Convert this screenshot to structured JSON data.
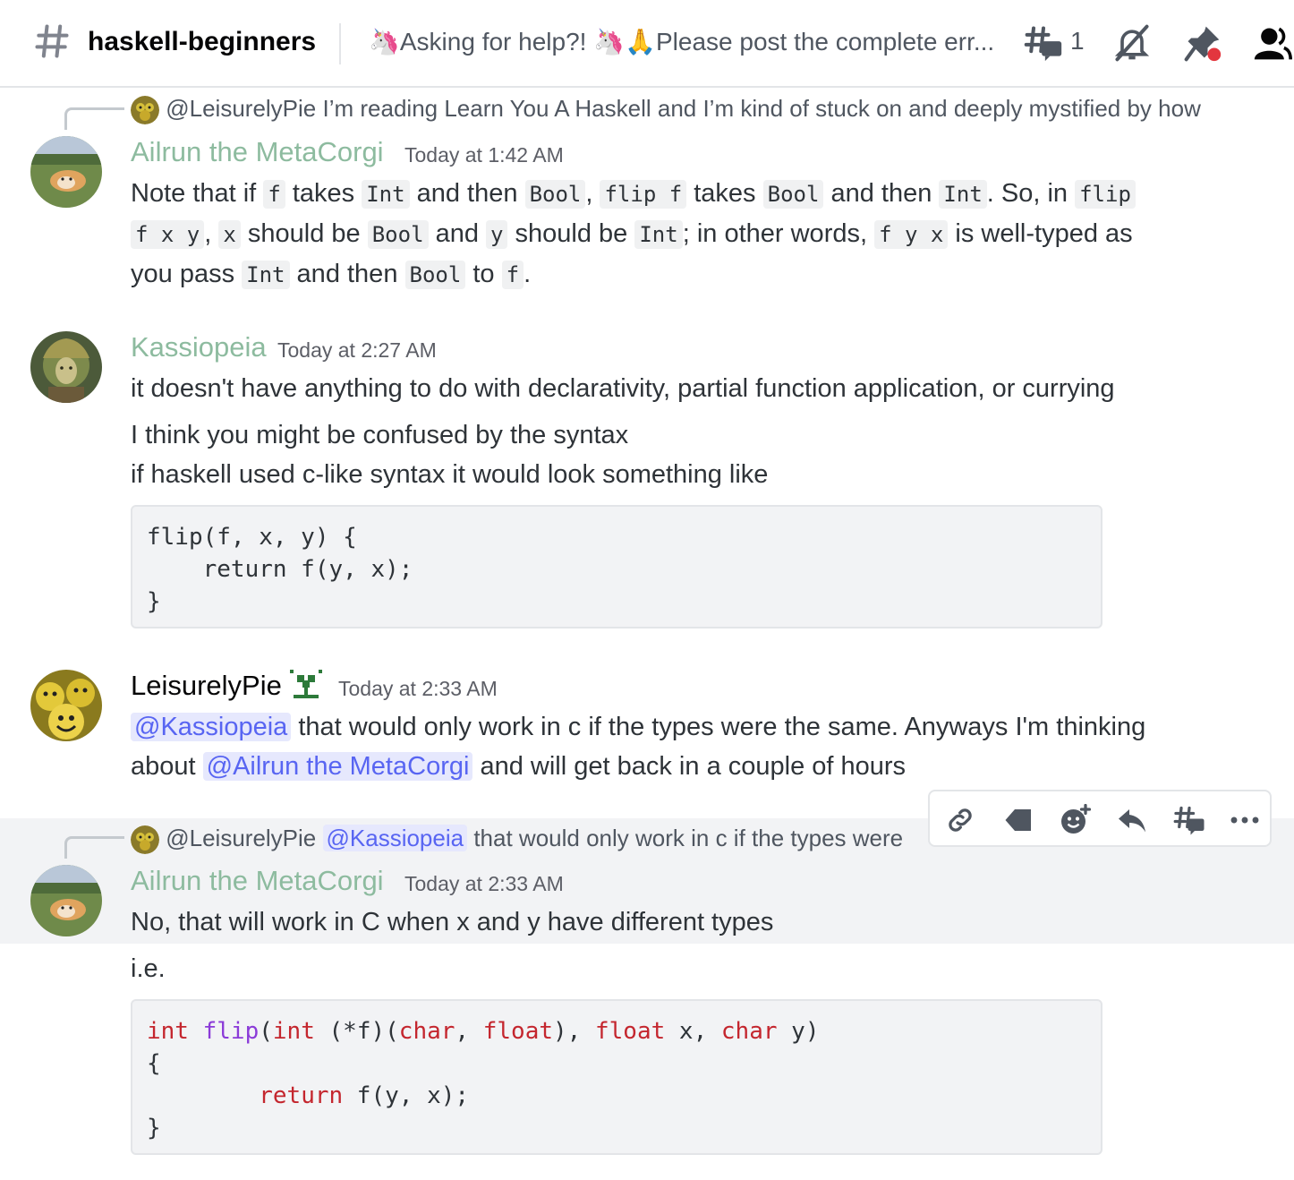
{
  "header": {
    "channel": "haskell-beginners",
    "topic_part1": "Asking for help?!",
    "topic_part2": "Please post the complete err...",
    "threads_count": "1"
  },
  "messages": [
    {
      "reply": {
        "author": "@LeisurelyPie",
        "text": "I’m reading Learn You A Haskell and I’m kind of stuck on and deeply mystified by how"
      },
      "author": "Ailrun the MetaCorgi",
      "timestamp": "Today at 1:42 AM",
      "text": {
        "t1": "Note that if ",
        "c1": "f",
        "t2": " takes ",
        "c2": "Int",
        "t3": " and then ",
        "c3": "Bool",
        "t4": ", ",
        "c4": "flip f",
        "t5": " takes ",
        "c5": "Bool",
        "t6": " and then ",
        "c6": "Int",
        "t7": ". So, in ",
        "c7": "flip",
        "c8": "f x y",
        "t8": ", ",
        "c9": "x",
        "t9": " should be ",
        "c10": "Bool",
        "t10": " and ",
        "c11": "y",
        "t11": " should be ",
        "c12": "Int",
        "t12": "; in other words, ",
        "c13": "f y x",
        "t13": " is well-typed as",
        "t14": "you pass ",
        "c14": "Int",
        "t15": " and then ",
        "c15": "Bool",
        "t16": " to ",
        "c16": "f",
        "t17": "."
      }
    },
    {
      "author": "Kassiopeia",
      "timestamp": "Today at 2:27 AM",
      "line1": "it doesn't have anything to do with declarativity, partial function application, or currying",
      "line2": "I think you might be confused by the syntax",
      "line3": "if haskell used c-like syntax it would look something like",
      "code": "flip(f, x, y) {\n    return f(y, x);\n}"
    },
    {
      "author": "LeisurelyPie",
      "timestamp": "Today at 2:33 AM",
      "mention1": "@Kassiopeia",
      "t1": " that would only work in c if the types were the same. Anyways I'm thinking",
      "t2": "about ",
      "mention2": "@Ailrun the MetaCorgi",
      "t3": " and will get back in a couple of hours"
    },
    {
      "reply": {
        "author": "@LeisurelyPie",
        "mention": "@Kassiopeia",
        "text": "that would only work in c if the types were"
      },
      "author": "Ailrun the MetaCorgi",
      "timestamp": "Today at 2:33 AM",
      "line1": "No, that will work in C when x and y have different types",
      "line2": "i.e.",
      "code": {
        "l1_a": "int",
        "l1_b": "flip",
        "l1_c": "(",
        "l1_d": "int",
        "l1_e": " (*f)(",
        "l1_f": "char",
        "l1_g": ", ",
        "l1_h": "float",
        "l1_i": "), ",
        "l1_j": "float",
        "l1_k": " x, ",
        "l1_l": "char",
        "l1_m": " y)",
        "l2": "{",
        "l3_a": "return",
        "l3_b": " f(y, x);",
        "l4": "}"
      }
    }
  ],
  "colors": {
    "accent": "#5865f2",
    "username_green": "#8dbb9f",
    "code_purple": "#8b3bd8",
    "code_red": "#c4262e",
    "unread_dot": "#e3363e"
  }
}
